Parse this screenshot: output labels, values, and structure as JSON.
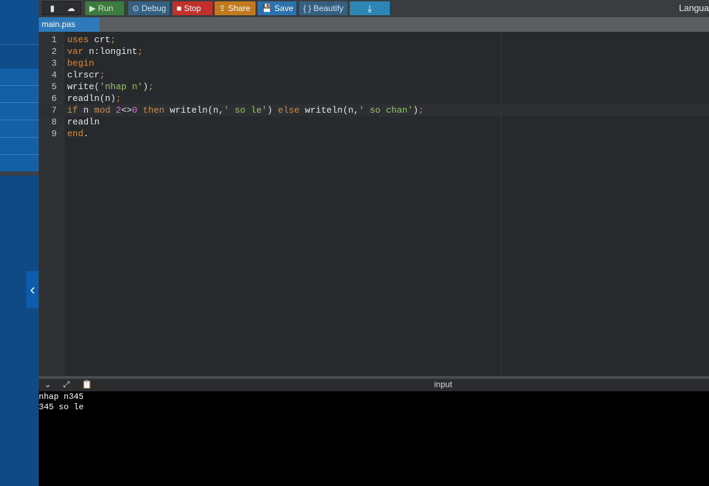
{
  "toolbar": {
    "icons": [
      "new-file-icon",
      "upload-icon"
    ],
    "run_label": "▶ Run",
    "debug_label": "⊙ Debug",
    "stop_label": "■ Stop",
    "share_label": "⇪ Share",
    "save_label": "💾 Save",
    "beautify_label": "{ } Beautify",
    "download_label": "⤓",
    "language_label": "Langua"
  },
  "tab": {
    "filename": "main.pas"
  },
  "editor": {
    "lines": [
      {
        "n": "1",
        "segments": [
          [
            "kw",
            "uses "
          ],
          [
            "op",
            "crt"
          ],
          [
            "kw",
            ";"
          ]
        ]
      },
      {
        "n": "2",
        "segments": [
          [
            "kw",
            "var "
          ],
          [
            "op",
            "n:longint"
          ],
          [
            "kw",
            ";"
          ]
        ]
      },
      {
        "n": "3",
        "segments": [
          [
            "kw",
            "begin"
          ]
        ]
      },
      {
        "n": "4",
        "segments": [
          [
            "op",
            "clrscr"
          ],
          [
            "kw",
            ";"
          ]
        ]
      },
      {
        "n": "5",
        "segments": [
          [
            "op",
            "write("
          ],
          [
            "str",
            "'nhap n'"
          ],
          [
            "op",
            ")"
          ],
          [
            "kw",
            ";"
          ]
        ]
      },
      {
        "n": "6",
        "segments": [
          [
            "op",
            "readln(n)"
          ],
          [
            "kw",
            ";"
          ]
        ]
      },
      {
        "n": "7",
        "segments": [
          [
            "kw",
            "if "
          ],
          [
            "op",
            "n "
          ],
          [
            "kw",
            "mod "
          ],
          [
            "num",
            "2"
          ],
          [
            "op",
            "<>"
          ],
          [
            "num",
            "0 "
          ],
          [
            "kw",
            "then "
          ],
          [
            "op",
            "writeln(n,"
          ],
          [
            "str",
            "' so le'"
          ],
          [
            "op",
            ") "
          ],
          [
            "kw",
            "else "
          ],
          [
            "op",
            "writeln(n,"
          ],
          [
            "str",
            "' so chan'"
          ],
          [
            "op",
            ")"
          ],
          [
            "kw",
            ";"
          ]
        ]
      },
      {
        "n": "8",
        "segments": [
          [
            "op",
            "readln"
          ]
        ]
      },
      {
        "n": "9",
        "segments": [
          [
            "kw",
            "end"
          ],
          [
            "op",
            "."
          ]
        ]
      }
    ]
  },
  "output": {
    "header_label": "input",
    "icons": [
      "chevron-down-icon",
      "expand-icon",
      "clipboard-icon"
    ],
    "console_lines": [
      "nhap n345",
      "345 so le"
    ]
  }
}
